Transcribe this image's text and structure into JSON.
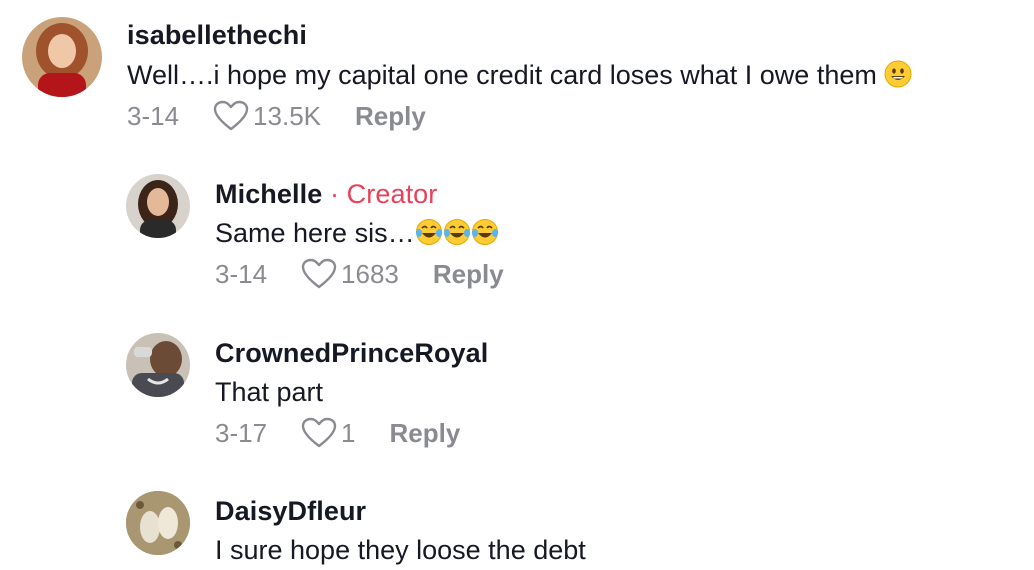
{
  "comments": [
    {
      "username": "isabellethechi",
      "text": "Well….i hope my capital one credit card loses what I owe them",
      "emoji": "grinning-face",
      "date": "3-14",
      "likes": "13.5K",
      "reply_label": "Reply"
    },
    {
      "username": "Michelle",
      "creator_tag": "· Creator",
      "text": "Same here sis…",
      "emoji": "tears-of-joy x3",
      "date": "3-14",
      "likes": "1683",
      "reply_label": "Reply"
    },
    {
      "username": "CrownedPrinceRoyal",
      "text": "That part",
      "date": "3-17",
      "likes": "1",
      "reply_label": "Reply"
    },
    {
      "username": "DaisyDfleur",
      "text": "I sure hope they loose the debt"
    }
  ],
  "colors": {
    "creator": "#e8415b",
    "meta": "#8a8b91",
    "text": "#161823"
  }
}
